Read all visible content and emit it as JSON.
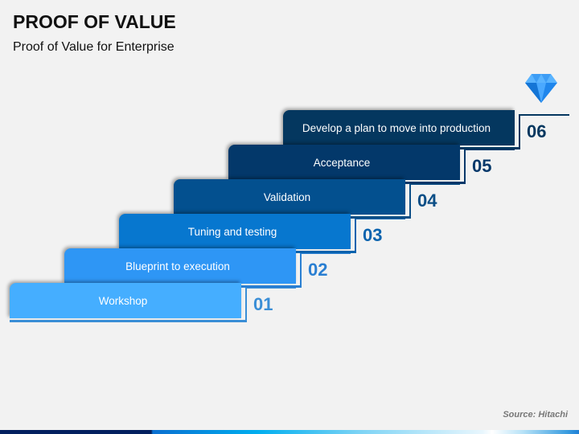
{
  "header": {
    "title": "PROOF OF VALUE",
    "subtitle": "Proof of Value for Enterprise"
  },
  "steps": [
    {
      "number": "01",
      "label": "Workshop",
      "color": "#45AEFF",
      "accent": "#3A8ED6"
    },
    {
      "number": "02",
      "label": "Blueprint to execution",
      "color": "#2E96F5",
      "accent": "#2A7FD2"
    },
    {
      "number": "03",
      "label": "Tuning and testing",
      "color": "#0777CF",
      "accent": "#0A63AE"
    },
    {
      "number": "04",
      "label": "Validation",
      "color": "#03508F",
      "accent": "#0B4E86"
    },
    {
      "number": "05",
      "label": "Acceptance",
      "color": "#03386A",
      "accent": "#05386A"
    },
    {
      "number": "06",
      "label": "Develop a plan to move into production",
      "color": "#04375F",
      "accent": "#04375F"
    }
  ],
  "icons": {
    "top": "diamond-icon"
  },
  "source": "Source: Hitachi"
}
